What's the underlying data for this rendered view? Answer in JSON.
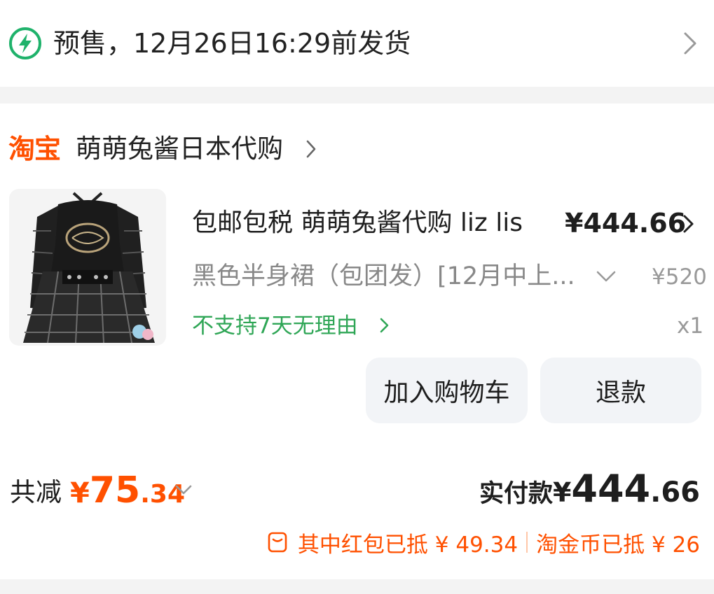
{
  "shipping": {
    "icon": "lightning-circle-icon",
    "text": "预售，12月26日16:29前发货"
  },
  "shop": {
    "logo_text": "淘宝",
    "name": "萌萌兔酱日本代购"
  },
  "product": {
    "title": "包邮包税 萌萌兔酱代购 liz lis",
    "price": "¥444.66",
    "spec": "黑色半身裙（包团发）[12月中上...",
    "original_price": "¥520",
    "return_policy": "不支持7天无理由",
    "quantity": "x1",
    "image_desc_icon": "product-thumbnail"
  },
  "actions": {
    "add_to_cart": "加入购物车",
    "refund": "退款"
  },
  "totals": {
    "discount_label": "共减",
    "discount_yen": "¥",
    "discount_int": "75",
    "discount_dec": ".34",
    "paid_label": "实付款",
    "paid_yen": "¥",
    "paid_int": "444",
    "paid_dec": ".66",
    "redpacket_text": "其中红包已抵 ¥ 49.34",
    "coin_text": "淘金币已抵 ¥ 26"
  },
  "colors": {
    "accent": "#ff5000",
    "green": "#2fa656",
    "shipping_icon": "#1fb26b"
  }
}
